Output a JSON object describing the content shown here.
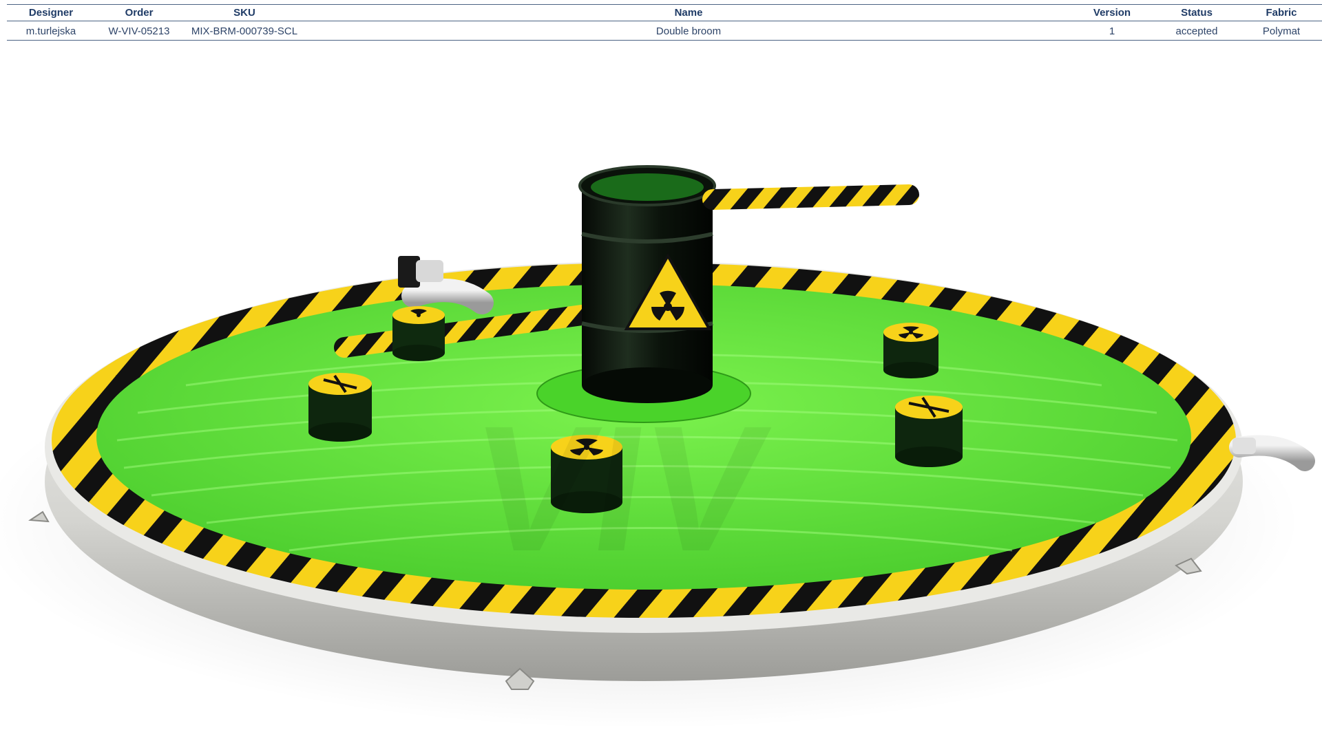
{
  "spec_table": {
    "headers": {
      "designer": "Designer",
      "order": "Order",
      "sku": "SKU",
      "name": "Name",
      "version": "Version",
      "status": "Status",
      "fabric": "Fabric"
    },
    "row": {
      "designer": "m.turlejska",
      "order": "W-VIV-05213",
      "sku": "MIX-BRM-000739-SCL",
      "name": "Double broom",
      "version": "1",
      "status": "accepted",
      "fabric": "Polymat"
    }
  },
  "render": {
    "watermark": "VIV",
    "colors": {
      "mat_green": "#5fe03a",
      "hazard_yellow": "#f7d21a",
      "hazard_black": "#111111",
      "base_grey": "#d9d9d6",
      "barrel_black": "#0f1a0f"
    },
    "icons": [
      "radiation-icon",
      "cross-icon"
    ]
  }
}
